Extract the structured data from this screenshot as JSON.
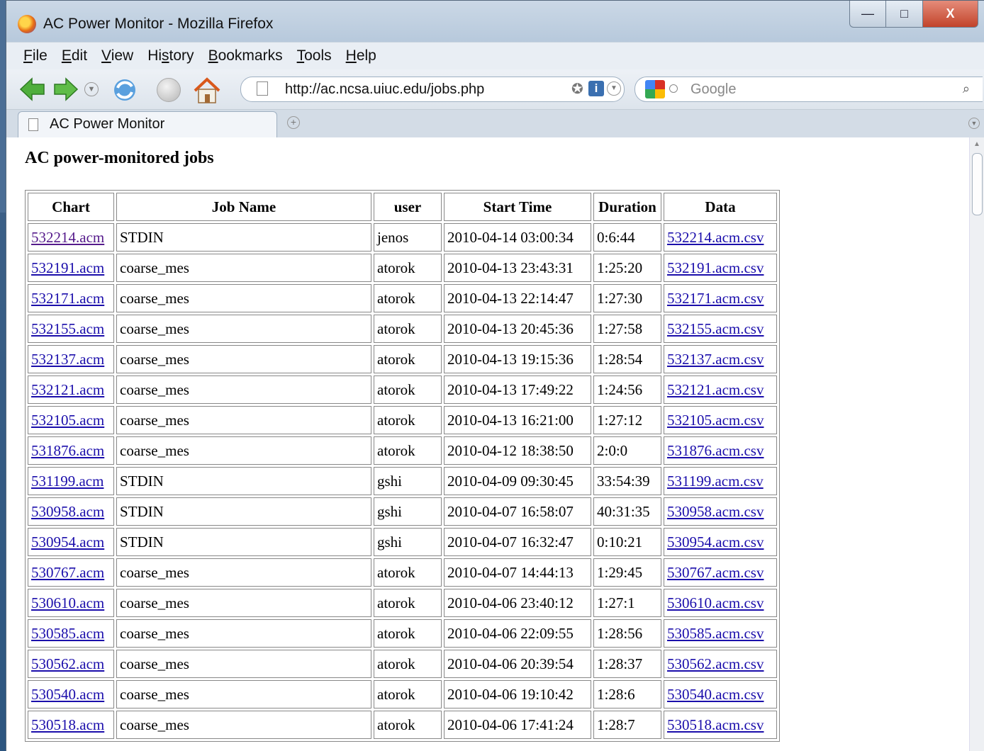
{
  "window": {
    "title": "AC Power Monitor - Mozilla Firefox",
    "minimize": "—",
    "maximize": "□",
    "close": "X"
  },
  "menu": [
    {
      "underline": "F",
      "rest": "ile"
    },
    {
      "underline": "E",
      "rest": "dit"
    },
    {
      "underline": "V",
      "rest": "iew"
    },
    {
      "pre": "Hi",
      "underline": "s",
      "rest": "tory"
    },
    {
      "underline": "B",
      "rest": "ookmarks"
    },
    {
      "underline": "T",
      "rest": "ools"
    },
    {
      "underline": "H",
      "rest": "elp"
    }
  ],
  "toolbar": {
    "url": "http://ac.ncsa.uiuc.edu/jobs.php",
    "search_placeholder": "Google"
  },
  "tabs": [
    {
      "label": "AC Power Monitor"
    }
  ],
  "page": {
    "heading": "AC power-monitored jobs",
    "columns": [
      "Chart",
      "Job Name",
      "user",
      "Start Time",
      "Duration",
      "Data"
    ],
    "rows": [
      [
        "532214.acm",
        "STDIN",
        "jenos",
        "2010-04-14 03:00:34",
        "0:6:44",
        "532214.acm.csv"
      ],
      [
        "532191.acm",
        "coarse_mes",
        "atorok",
        "2010-04-13 23:43:31",
        "1:25:20",
        "532191.acm.csv"
      ],
      [
        "532171.acm",
        "coarse_mes",
        "atorok",
        "2010-04-13 22:14:47",
        "1:27:30",
        "532171.acm.csv"
      ],
      [
        "532155.acm",
        "coarse_mes",
        "atorok",
        "2010-04-13 20:45:36",
        "1:27:58",
        "532155.acm.csv"
      ],
      [
        "532137.acm",
        "coarse_mes",
        "atorok",
        "2010-04-13 19:15:36",
        "1:28:54",
        "532137.acm.csv"
      ],
      [
        "532121.acm",
        "coarse_mes",
        "atorok",
        "2010-04-13 17:49:22",
        "1:24:56",
        "532121.acm.csv"
      ],
      [
        "532105.acm",
        "coarse_mes",
        "atorok",
        "2010-04-13 16:21:00",
        "1:27:12",
        "532105.acm.csv"
      ],
      [
        "531876.acm",
        "coarse_mes",
        "atorok",
        "2010-04-12 18:38:50",
        "2:0:0",
        "531876.acm.csv"
      ],
      [
        "531199.acm",
        "STDIN",
        "gshi",
        "2010-04-09 09:30:45",
        "33:54:39",
        "531199.acm.csv"
      ],
      [
        "530958.acm",
        "STDIN",
        "gshi",
        "2010-04-07 16:58:07",
        "40:31:35",
        "530958.acm.csv"
      ],
      [
        "530954.acm",
        "STDIN",
        "gshi",
        "2010-04-07 16:32:47",
        "0:10:21",
        "530954.acm.csv"
      ],
      [
        "530767.acm",
        "coarse_mes",
        "atorok",
        "2010-04-07 14:44:13",
        "1:29:45",
        "530767.acm.csv"
      ],
      [
        "530610.acm",
        "coarse_mes",
        "atorok",
        "2010-04-06 23:40:12",
        "1:27:1",
        "530610.acm.csv"
      ],
      [
        "530585.acm",
        "coarse_mes",
        "atorok",
        "2010-04-06 22:09:55",
        "1:28:56",
        "530585.acm.csv"
      ],
      [
        "530562.acm",
        "coarse_mes",
        "atorok",
        "2010-04-06 20:39:54",
        "1:28:37",
        "530562.acm.csv"
      ],
      [
        "530540.acm",
        "coarse_mes",
        "atorok",
        "2010-04-06 19:10:42",
        "1:28:6",
        "530540.acm.csv"
      ],
      [
        "530518.acm",
        "coarse_mes",
        "atorok",
        "2010-04-06 17:41:24",
        "1:28:7",
        "530518.acm.csv"
      ]
    ],
    "visited_chart_links": [
      0
    ]
  },
  "colors": {
    "link": "#1a0dab",
    "visited_link": "#551a8b",
    "titlebar": "#c2d2e3"
  },
  "icons": [
    "firefox-logo",
    "back-arrow",
    "forward-arrow",
    "history-dropdown",
    "reload",
    "stop",
    "home",
    "page",
    "bookmark-star",
    "site-info",
    "feed",
    "google",
    "search",
    "new-tab",
    "tab-list"
  ]
}
